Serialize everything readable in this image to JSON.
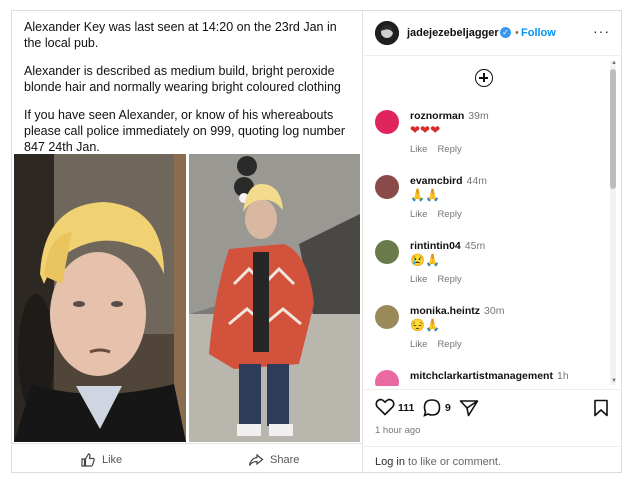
{
  "post": {
    "paragraphs": [
      "Alexander Key was last seen at 14:20 on the 23rd Jan in the local pub.",
      "Alexander is described as medium build, bright peroxide blonde hair and normally wearing bright coloured clothing",
      "If you have seen Alexander, or know of his whereabouts please call police immediately on 999, quoting log number 847 24th Jan."
    ]
  },
  "actions": {
    "like": "Like",
    "share": "Share"
  },
  "header": {
    "username": "jadejezebeljagger",
    "dot": "•",
    "follow": "Follow",
    "more": "···"
  },
  "comments": [
    {
      "user": "roznorman",
      "time": "39m",
      "text": "❤❤❤",
      "like": "Like",
      "reply": "Reply",
      "avatar_color": "#e0245e"
    },
    {
      "user": "evamcbird",
      "time": "44m",
      "text": "🙏🙏",
      "like": "Like",
      "reply": "Reply",
      "avatar_color": "#8a4a4a"
    },
    {
      "user": "rintintin04",
      "time": "45m",
      "text": "😢🙏",
      "like": "Like",
      "reply": "Reply",
      "avatar_color": "#6b7a4a"
    },
    {
      "user": "monika.heintz",
      "time": "30m",
      "text": "😔🙏",
      "like": "Like",
      "reply": "Reply",
      "avatar_color": "#9a8a5a"
    },
    {
      "user": "mitchclarkartistmanagement",
      "time": "1h",
      "text": "",
      "like": "",
      "reply": "",
      "avatar_color": "#e86aa0"
    }
  ],
  "stats": {
    "likes": "111",
    "comments": "9",
    "time_ago": "1 hour ago"
  },
  "login": {
    "prefix": "Log in",
    "suffix": " to like or comment."
  },
  "colors": {
    "accent": "#0095f6",
    "verified": "#3897f0",
    "heart": "#e0245e"
  }
}
